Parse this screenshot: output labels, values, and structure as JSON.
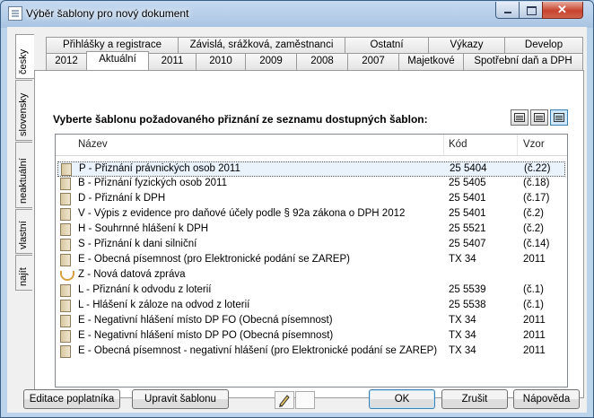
{
  "window": {
    "title": "Výběr šablony pro nový dokument"
  },
  "side_tabs": [
    "česky",
    "slovensky",
    "neaktuální",
    "vlastní",
    "najít"
  ],
  "tabs_row1": [
    "Přihlášky a registrace",
    "Závislá, srážková, zaměstnanci",
    "Ostatní",
    "Výkazy",
    "Develop"
  ],
  "tabs_row2": [
    "2012",
    "Aktuální",
    "2011",
    "2010",
    "2009",
    "2008",
    "2007",
    "Majetkové",
    "Spotřební daň a DPH"
  ],
  "instruction": "Vyberte šablonu požadovaného přiznání ze seznamu dostupných šablon:",
  "columns": {
    "name": "Název",
    "code": "Kód",
    "vzor": "Vzor"
  },
  "rows": [
    {
      "name": "P - Přiznání právnických osob 2011",
      "code": "25 5404",
      "vzor": "(č.22)"
    },
    {
      "name": "B - Přiznání fyzických osob 2011",
      "code": "25 5405",
      "vzor": "(č.18)"
    },
    {
      "name": "D - Přiznání k DPH",
      "code": "25 5401",
      "vzor": "(č.17)"
    },
    {
      "name": "V - Výpis z evidence pro daňové účely podle § 92a zákona o DPH 2012",
      "code": "25 5401",
      "vzor": "(č.2)"
    },
    {
      "name": "H - Souhrnné hlášení k DPH",
      "code": "25 5521",
      "vzor": "(č.2)"
    },
    {
      "name": "S - Přiznání k dani silniční",
      "code": "25 5407",
      "vzor": "(č.14)"
    },
    {
      "name": "E - Obecná písemnost (pro Elektronické podání se ZAREP)",
      "code": "TX 34",
      "vzor": "2011"
    },
    {
      "name": "Z - Nová datová zpráva",
      "code": "",
      "vzor": ""
    },
    {
      "name": "L - Přiznání k odvodu z loterií",
      "code": "25 5539",
      "vzor": "(č.1)"
    },
    {
      "name": "L - Hlášení k záloze na odvod z loterií",
      "code": "25 5538",
      "vzor": "(č.1)"
    },
    {
      "name": "E - Negativní hlášení místo DP FO (Obecná písemnost)",
      "code": "TX 34",
      "vzor": "2011"
    },
    {
      "name": "E - Negativní hlášení místo DP PO (Obecná písemnost)",
      "code": "TX 34",
      "vzor": "2011"
    },
    {
      "name": "E - Obecná písemnost - negativní hlášení (pro Elektronické podání se ZAREP)",
      "code": "TX 34",
      "vzor": "2011"
    }
  ],
  "buttons": {
    "edit_payer": "Editace poplatníka",
    "edit_template": "Upravit šablonu",
    "ok": "OK",
    "cancel": "Zrušit",
    "help": "Nápověda"
  }
}
